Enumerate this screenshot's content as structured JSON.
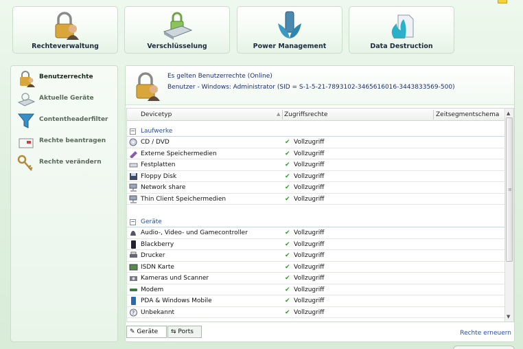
{
  "modules": [
    {
      "label": "Rechteverwaltung",
      "icon": "lock-user-icon"
    },
    {
      "label": "Verschlüsselung",
      "icon": "lock-drive-icon"
    },
    {
      "label": "Power Management",
      "icon": "power-leaf-icon"
    },
    {
      "label": "Data Destruction",
      "icon": "document-flame-icon"
    }
  ],
  "sidebar": {
    "items": [
      {
        "label": "Benutzerrechte",
        "icon": "lock-user-icon",
        "active": true
      },
      {
        "label": "Aktuelle Geräte",
        "icon": "device-icon"
      },
      {
        "label": "Contentheaderfilter",
        "icon": "filter-icon"
      },
      {
        "label": "Rechte beantragen",
        "icon": "mail-icon"
      },
      {
        "label": "Rechte verändern",
        "icon": "keys-icon"
      }
    ]
  },
  "header": {
    "line1": "Es gelten Benutzerrechte (Online)",
    "line2": "Benutzer - Windows: Administrator (SID = S-1-5-21-7893102-3465616016-3443833569-500)"
  },
  "table": {
    "columns": [
      "Devicetyp",
      "Zugriffsrechte",
      "Zeitsegmentschema"
    ],
    "groups": [
      {
        "name": "Laufwerke",
        "rows": [
          {
            "device": "CD / DVD",
            "right": "Vollzugriff",
            "icon": "cd-icon"
          },
          {
            "device": "Externe Speichermedien",
            "right": "Vollzugriff",
            "icon": "usb-stick-icon"
          },
          {
            "device": "Festplatten",
            "right": "Vollzugriff",
            "icon": "harddisk-icon"
          },
          {
            "device": "Floppy Disk",
            "right": "Vollzugriff",
            "icon": "floppy-icon"
          },
          {
            "device": "Network share",
            "right": "Vollzugriff",
            "icon": "network-icon"
          },
          {
            "device": "Thin Client Speichermedien",
            "right": "Vollzugriff",
            "icon": "network-icon"
          }
        ]
      },
      {
        "name": "Geräte",
        "rows": [
          {
            "device": "Audio-, Video- und Gamecontroller",
            "right": "Vollzugriff",
            "icon": "gamepad-icon"
          },
          {
            "device": "Blackberry",
            "right": "Vollzugriff",
            "icon": "phone-icon"
          },
          {
            "device": "Drucker",
            "right": "Vollzugriff",
            "icon": "printer-icon"
          },
          {
            "device": "ISDN Karte",
            "right": "Vollzugriff",
            "icon": "card-icon"
          },
          {
            "device": "Kameras und Scanner",
            "right": "Vollzugriff",
            "icon": "camera-icon"
          },
          {
            "device": "Modem",
            "right": "Vollzugriff",
            "icon": "modem-icon"
          },
          {
            "device": "PDA & Windows Mobile",
            "right": "Vollzugriff",
            "icon": "pda-icon"
          },
          {
            "device": "Unbekannt",
            "right": "Vollzugriff",
            "icon": "unknown-device-icon"
          }
        ]
      }
    ]
  },
  "tabs": [
    {
      "label": "Geräte",
      "icon": "pencil-icon",
      "active": true
    },
    {
      "label": "Ports",
      "icon": "usb-icon",
      "active": false
    }
  ],
  "footer_link": "Rechte erneuern",
  "colors": {
    "accent_green": "#2f9a2a",
    "group_blue": "#2f4d8e",
    "link_blue": "#2a4ea8"
  }
}
